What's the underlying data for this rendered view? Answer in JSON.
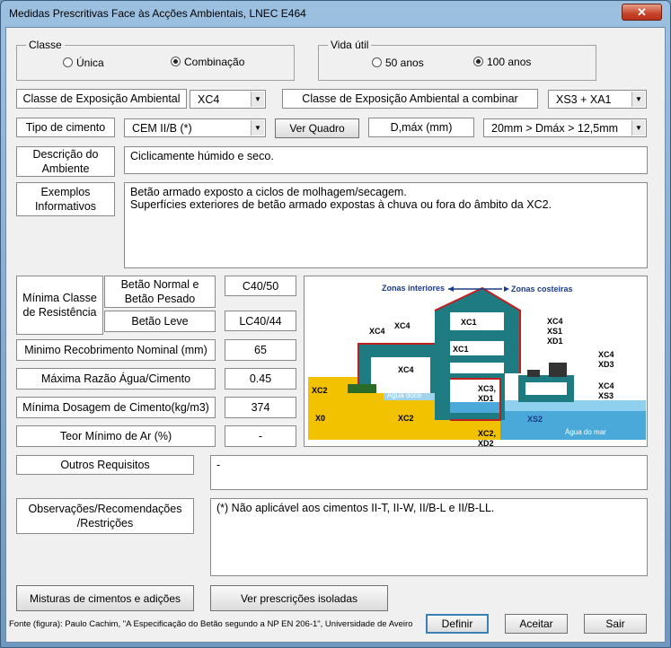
{
  "window": {
    "title": "Medidas Prescritivas Face às Acções Ambientais, LNEC E464",
    "close_glyph": "✕"
  },
  "classe": {
    "label": "Classe",
    "options": [
      "Única",
      "Combinação"
    ],
    "selected": "Combinação"
  },
  "vida_util": {
    "label": "Vida útil",
    "options": [
      "50 anos",
      "100 anos"
    ],
    "selected": "100 anos"
  },
  "exposicao": {
    "label": "Classe de Exposição Ambiental",
    "value": "XC4",
    "combinar_label": "Classe de Exposição Ambiental a combinar",
    "combinar_value": "XS3 + XA1"
  },
  "cimento": {
    "label": "Tipo de cimento",
    "value": "CEM II/B (*)",
    "ver_quadro": "Ver Quadro",
    "dmax_label": "D,máx (mm)",
    "dmax_value": "20mm > Dmáx > 12,5mm"
  },
  "descricao": {
    "label": "Descrição do Ambiente",
    "value": "Ciclicamente húmido e seco."
  },
  "exemplos": {
    "label": "Exemplos Informativos",
    "value": "Betão armado exposto a ciclos de molhagem/secagem.\nSuperfícies exteriores de betão armado expostas à chuva ou fora do âmbito da XC2."
  },
  "resistencia": {
    "label": "Mínima Classe de Resistência",
    "normal_label": "Betão Normal e Betão Pesado",
    "normal_value": "C40/50",
    "leve_label": "Betão Leve",
    "leve_value": "LC40/44"
  },
  "recobrimento": {
    "label": "Minimo Recobrimento Nominal (mm)",
    "value": "65"
  },
  "razao": {
    "label": "Máxima Razão Água/Cimento",
    "value": "0.45"
  },
  "dosagem": {
    "label": "Mínima Dosagem de Cimento(kg/m3)",
    "value": "374"
  },
  "ar": {
    "label": "Teor Mínimo de Ar (%)",
    "value": "-"
  },
  "outros": {
    "label": "Outros Requisitos",
    "value": "-"
  },
  "observacoes": {
    "label": "Observações/Recomendações /Restrições",
    "value": "(*) Não aplicável aos cimentos II-T, II-W, II/B-L e II/B-LL."
  },
  "figure": {
    "zonas_interiores": "Zonas interiores",
    "zonas_costeiras": "Zonas costeiras",
    "xc1_a": "XC1",
    "xc1_b": "XC1",
    "xc4_a": "XC4",
    "xc4_b": "XC4",
    "xc4_c": "XC4",
    "xc4_xs1_xd1": "XC4\nXS1\nXD1",
    "xc4_xd3": "XC4\nXD3",
    "xc4_xs3": "XC4\nXS3",
    "xc3_xd1": "XC3,\nXD1",
    "xc2_a": "XC2",
    "xc2_b": "XC2",
    "xc2_xd2": "XC2,\nXD2",
    "x0": "X0",
    "xs2": "XS2",
    "agua_doce": "Água doce",
    "agua_mar": "Água do mar"
  },
  "buttons": {
    "misturas": "Misturas de cimentos e adições",
    "prescricoes": "Ver prescrições isoladas",
    "definir": "Definir",
    "aceitar": "Aceitar",
    "sair": "Sair"
  },
  "footer": "Fonte (figura): Paulo Cachim, \"A Especificação do Betão segundo a NP EN 206-1\", Universidade de Aveiro"
}
